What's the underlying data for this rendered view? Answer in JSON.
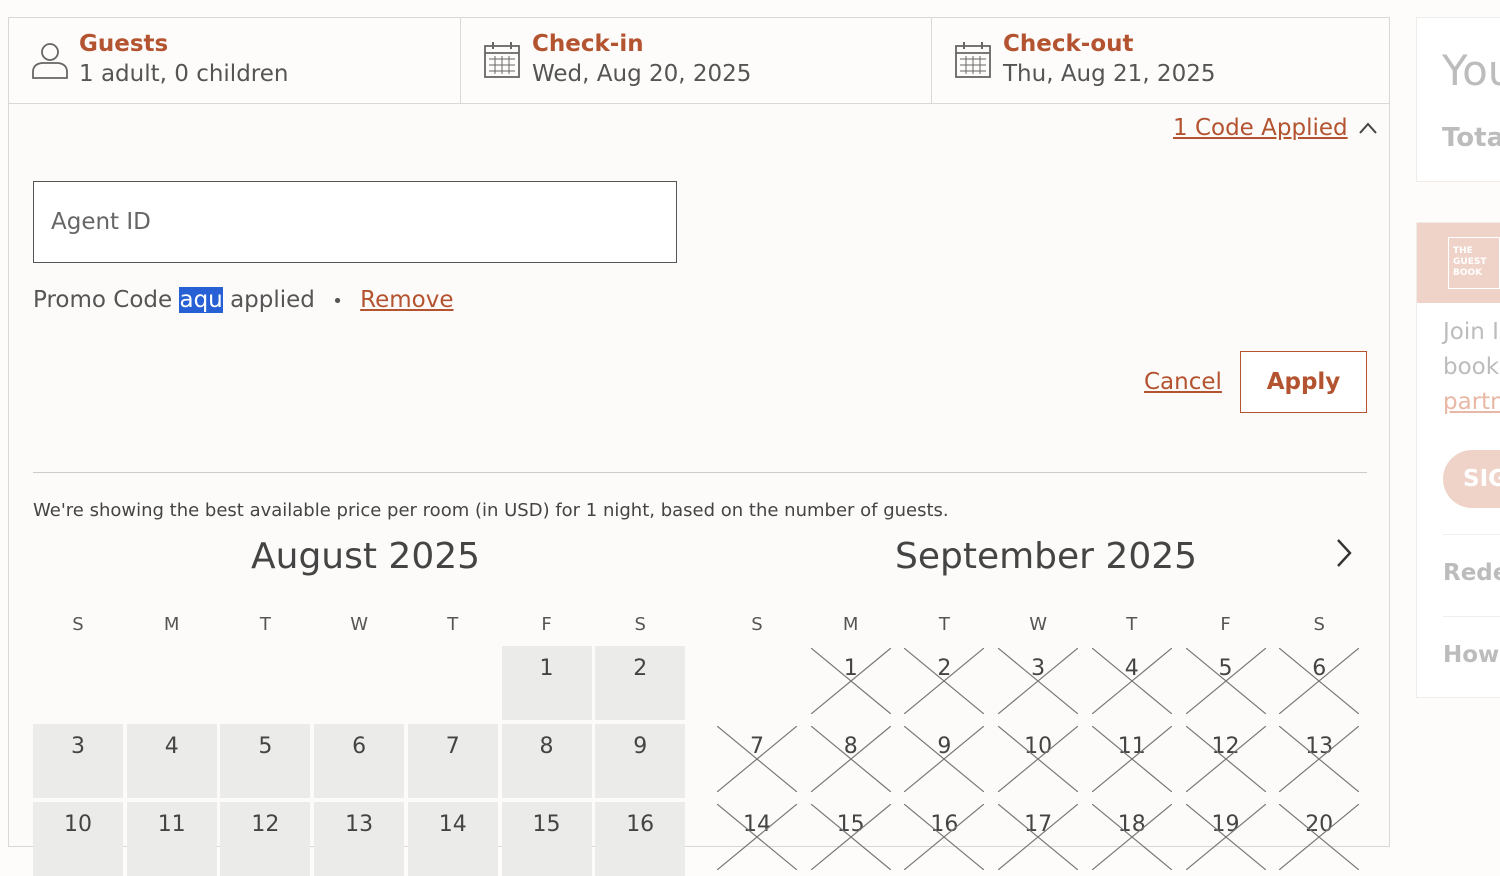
{
  "search_bar": {
    "guests": {
      "label": "Guests",
      "value": "1 adult, 0 children",
      "icon": "person-icon"
    },
    "checkin": {
      "label": "Check-in",
      "value": "Wed, Aug 20, 2025",
      "icon": "calendar-icon"
    },
    "checkout": {
      "label": "Check-out",
      "value": "Thu, Aug 21, 2025",
      "icon": "calendar-icon"
    }
  },
  "codes_toggle": {
    "label": "1 Code Applied",
    "icon": "chevron-up-icon"
  },
  "agent_id": {
    "placeholder": "Agent ID",
    "value": ""
  },
  "promo": {
    "prefix": "Promo Code",
    "code": "aqu",
    "suffix": "applied",
    "separator": "•",
    "remove_label": "Remove"
  },
  "actions": {
    "cancel_label": "Cancel",
    "apply_label": "Apply"
  },
  "note": "We're showing the best available price per room (in USD) for 1 night, based on the number of guests.",
  "calendar": {
    "weekdays": [
      "S",
      "M",
      "T",
      "W",
      "T",
      "F",
      "S"
    ],
    "months": [
      {
        "title": "August 2025",
        "days": [
          "1",
          "2",
          "3",
          "4",
          "5",
          "6",
          "7",
          "8",
          "9",
          "10",
          "11",
          "12",
          "13",
          "14",
          "15",
          "16"
        ]
      },
      {
        "title": "September 2025",
        "days": [
          "1",
          "2",
          "3",
          "4",
          "5",
          "6",
          "7",
          "8",
          "9",
          "10",
          "11",
          "12",
          "13",
          "14",
          "15",
          "16",
          "17",
          "18",
          "19",
          "20"
        ]
      }
    ],
    "next_icon": "chevron-right-icon"
  },
  "sidebar": {
    "top_title": "You",
    "top_sub": "Tota",
    "logo_text": "THE GUEST BOOK",
    "join_line1": "Join IH",
    "join_line2": "book",
    "join_link": "partn",
    "signup_label": "SIG",
    "redeem": "Rede",
    "how": "How"
  },
  "colors": {
    "accent": "#b3532f",
    "available_day": "#ebebea",
    "selection": "#2760d4",
    "brand_tint": "#efd3c9"
  }
}
